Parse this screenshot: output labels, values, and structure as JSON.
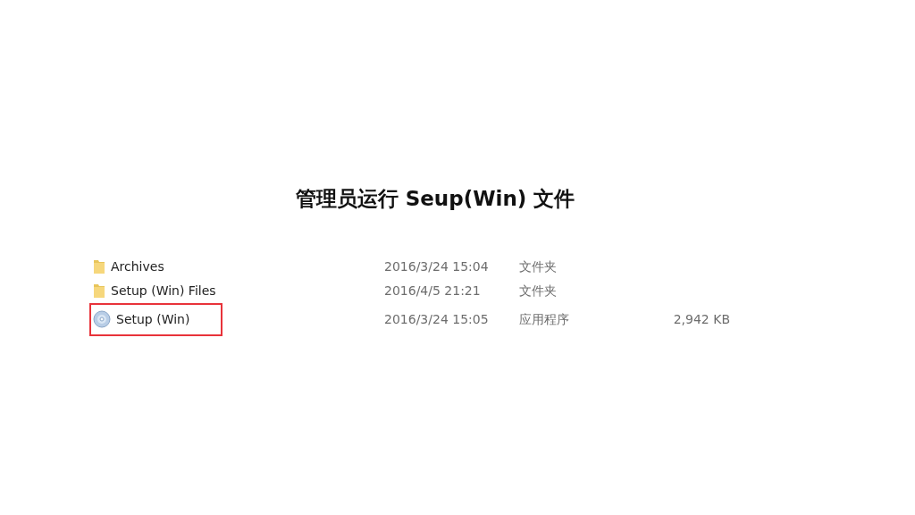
{
  "title": "管理员运行 Seup(Win) 文件",
  "files": [
    {
      "kind": "folder",
      "name": "Archives",
      "modified": "2016/3/24 15:04",
      "type": "文件夹",
      "highlighted": false
    },
    {
      "kind": "folder",
      "name": "Setup (Win) Files",
      "modified": "2016/4/5 21:21",
      "type": "文件夹",
      "highlighted": false
    },
    {
      "kind": "app",
      "name": "Setup (Win)",
      "modified": "2016/3/24 15:05",
      "type": "应用程序",
      "size": "2,942 KB",
      "highlighted": true
    }
  ]
}
